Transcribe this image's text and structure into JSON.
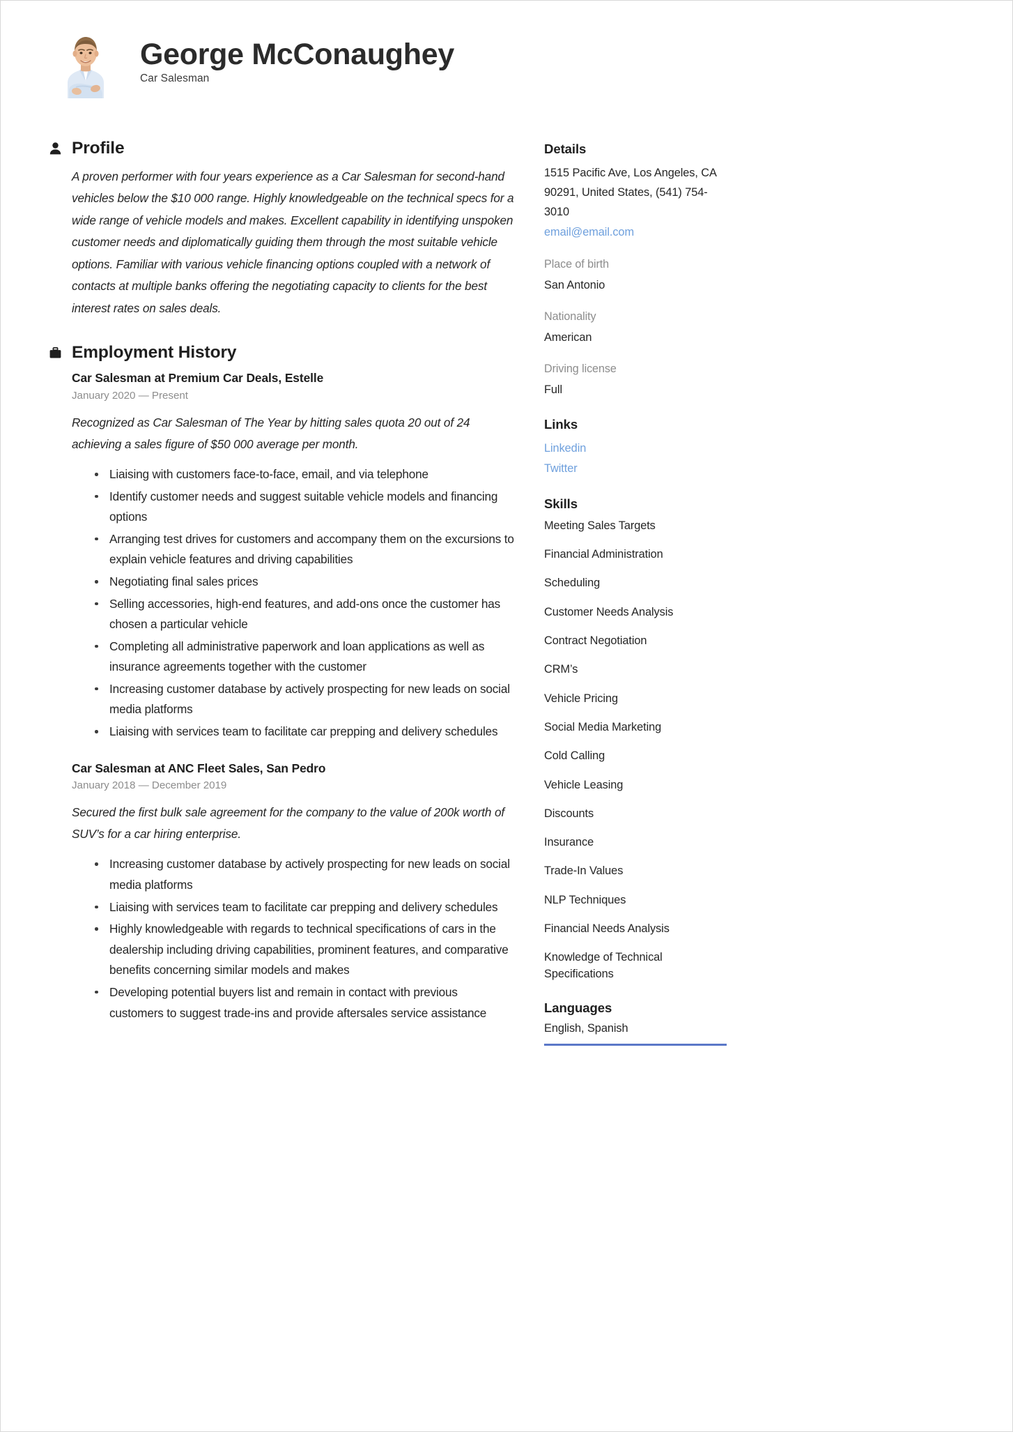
{
  "header": {
    "name": "George McConaughey",
    "job_title": "Car Salesman",
    "photo_alt": "portrait-photo"
  },
  "main": {
    "profile": {
      "title": "Profile",
      "icon": "person-icon",
      "text": "A proven performer with four years experience as a Car Salesman for second-hand vehicles below the $10 000 range. Highly knowledgeable on the technical specs for a wide range of vehicle models and makes. Excellent capability in identifying unspoken customer needs and diplomatically guiding them through the most suitable vehicle options. Familiar with various vehicle financing options coupled with a network of contacts at multiple banks offering the negotiating capacity to clients for the best interest rates on sales deals."
    },
    "employment": {
      "title": "Employment History",
      "icon": "briefcase-icon",
      "jobs": [
        {
          "heading": "Car Salesman at Premium Car Deals, Estelle",
          "dates": "January 2020 — Present",
          "summary": "Recognized as Car Salesman of The Year by hitting sales quota 20 out of 24 achieving a sales figure of $50 000 average per month.",
          "bullets": [
            "Liaising with customers face-to-face, email, and via telephone",
            "Identify customer needs and suggest suitable vehicle models and financing options",
            "Arranging test drives for customers and accompany them on the excursions to explain vehicle features and driving capabilities",
            "Negotiating final sales prices",
            "Selling accessories, high-end features, and add-ons once the customer has chosen a particular vehicle",
            "Completing all administrative paperwork and loan applications as well as insurance agreements together with the customer",
            "Increasing customer database by actively prospecting for new leads on social media platforms",
            "Liaising with services team to facilitate car prepping and delivery schedules"
          ]
        },
        {
          "heading": "Car Salesman at ANC Fleet Sales, San Pedro",
          "dates": "January 2018 — December 2019",
          "summary": "Secured the first bulk sale agreement for the company to the value of 200k worth of SUV’s for a car hiring enterprise.",
          "bullets": [
            "Increasing customer database by actively prospecting for new leads on social media platforms",
            "Liaising with services team to facilitate car prepping and delivery schedules",
            "Highly knowledgeable with regards to technical specifications of cars in the dealership including driving capabilities, prominent features, and comparative benefits concerning similar models and makes",
            "Developing potential buyers list and remain in contact with previous customers to suggest trade-ins and provide aftersales service assistance"
          ]
        }
      ]
    }
  },
  "sidebar": {
    "details": {
      "title": "Details",
      "address": "1515 Pacific Ave, Los Angeles, CA 90291, United States, (541) 754-3010",
      "email": "email@email.com",
      "fields": [
        {
          "label": "Place of birth",
          "value": "San Antonio"
        },
        {
          "label": "Nationality",
          "value": "American"
        },
        {
          "label": "Driving license",
          "value": "Full"
        }
      ]
    },
    "links": {
      "title": "Links",
      "items": [
        "Linkedin",
        "Twitter"
      ]
    },
    "skills": {
      "title": "Skills",
      "items": [
        "Meeting Sales Targets",
        "Financial Administration",
        "Scheduling",
        "Customer Needs Analysis",
        "Contract Negotiation",
        "CRM’s",
        "Vehicle Pricing",
        "Social Media Marketing",
        "Cold Calling",
        "Vehicle Leasing",
        "Discounts",
        "Insurance",
        "Trade-In Values",
        "NLP Techniques",
        "Financial Needs Analysis",
        "Knowledge of Technical Specifications"
      ]
    },
    "languages": {
      "title": "Languages",
      "value": "English, Spanish"
    }
  },
  "colors": {
    "link": "#6fa0dd",
    "accent_rule": "#5b78c8",
    "muted_label": "#8d8d8d",
    "text": "#262626"
  }
}
